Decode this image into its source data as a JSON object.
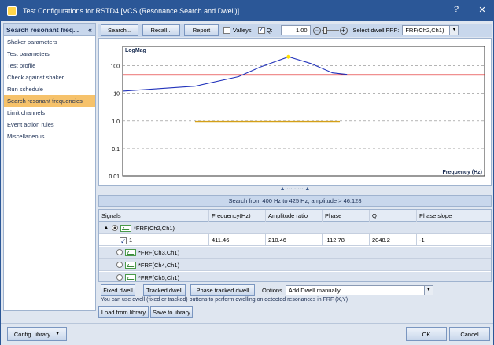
{
  "window": {
    "title": "Test Configurations for RSTD4 [VCS (Resonance Search and Dwell)]",
    "help_label": "?",
    "close_label": "✕"
  },
  "sidebar": {
    "header": "Search resonant freq...",
    "collapse_label": "«",
    "items": [
      {
        "label": "Shaker parameters"
      },
      {
        "label": "Test parameters"
      },
      {
        "label": "Test profile"
      },
      {
        "label": "Check against shaker"
      },
      {
        "label": "Run schedule"
      },
      {
        "label": "Search resonant frequencies"
      },
      {
        "label": "Limit channels"
      },
      {
        "label": "Event action rules"
      },
      {
        "label": "Miscellaneous"
      }
    ]
  },
  "toolbar": {
    "search_label": "Search...",
    "recall_label": "Recall...",
    "report_label": "Report",
    "valleys_label": "Valleys",
    "valleys_checked": false,
    "q_label": "Q:",
    "q_checked": true,
    "q_value": "1.00",
    "dwell_frf_label": "Select dwell FRF:",
    "dwell_frf_value": "FRF(Ch2,Ch1)"
  },
  "chart_data": {
    "type": "line",
    "title": "LogMag",
    "xlabel": "Frequency (Hz)",
    "ylabel": "",
    "yscale": "log",
    "ylim": [
      0.01,
      500
    ],
    "y_ticks": [
      "100",
      "10",
      "1.0",
      "0.1",
      "0.01"
    ],
    "grid": "dashed horizontal",
    "threshold": {
      "value": 46.128,
      "color": "#e02020"
    },
    "series": [
      {
        "color": "#2233bb",
        "x": [
          400,
          405,
          408,
          409.5,
          411.46,
          413,
          414.5,
          415.5
        ],
        "values": [
          12,
          18,
          40,
          90,
          210.46,
          120,
          55,
          48
        ]
      },
      {
        "color": "#d4a017",
        "x": [
          405,
          415
        ],
        "values": [
          0.95,
          0.95
        ]
      }
    ],
    "peak": {
      "x": 411.46,
      "value": 210.46,
      "color": "#ffe000"
    },
    "x_range": [
      400,
      425
    ]
  },
  "search_info": "Search from 400 Hz to 425 Hz, amplitude > 46.128",
  "grid": {
    "columns": [
      "Signals",
      "Frequency(Hz)",
      "Amplitude ratio",
      "Phase",
      "Q",
      "Phase slope"
    ],
    "groups": [
      {
        "expander": "▲",
        "name": "*FRF(Ch2,Ch1)",
        "selected": true
      },
      {
        "expander": "",
        "name": "*FRF(Ch3,Ch1)",
        "selected": false
      },
      {
        "expander": "",
        "name": "*FRF(Ch4,Ch1)",
        "selected": false
      },
      {
        "expander": "",
        "name": "*FRF(Ch5,Ch1)",
        "selected": false
      }
    ],
    "rows": [
      {
        "index": "1",
        "frequency": "411.46",
        "amplitude": "210.46",
        "phase": "-112.78",
        "q": "2048.2",
        "phase_slope": "-1"
      }
    ]
  },
  "dwell": {
    "fixed_label": "Fixed dwell",
    "tracked_label": "Tracked dwell",
    "phase_tracked_label": "Phase tracked dwell",
    "options_label": "Options",
    "options_value": "Add Dwell manually",
    "info": "You can use dwell (fixed or tracked) buttons to perform dwelling on detected resonances in FRF (X,Y)"
  },
  "library": {
    "load_label": "Load from library",
    "save_label": "Save to library"
  },
  "footer": {
    "config_label": "Config. library",
    "ok_label": "OK",
    "cancel_label": "Cancel"
  }
}
